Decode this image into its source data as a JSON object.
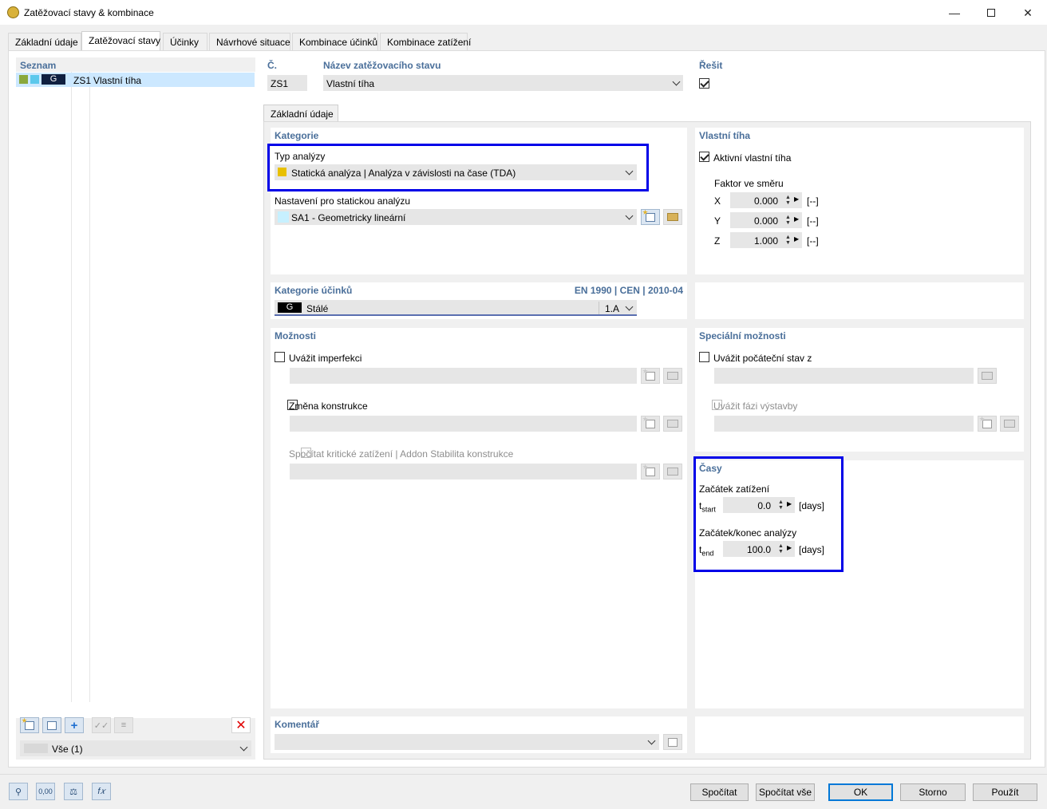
{
  "window": {
    "title": "Zatěžovací stavy & kombinace"
  },
  "tabs": [
    "Základní údaje",
    "Zatěžovací stavy",
    "Účinky",
    "Návrhové situace",
    "Kombinace účinků",
    "Kombinace zatížení"
  ],
  "list": {
    "header": "Seznam",
    "item": {
      "tag": "G",
      "id": "ZS1",
      "name": "Vlastní tíha",
      "colors": [
        "#8aa83c",
        "#5bc8ec"
      ]
    },
    "filter": "Vše (1)"
  },
  "number": {
    "label": "Č.",
    "value": "ZS1"
  },
  "name": {
    "label": "Název zatěžovacího stavu",
    "value": "Vlastní tíha"
  },
  "solve": {
    "label": "Řešit",
    "checked": true
  },
  "subtab": "Základní údaje",
  "category": {
    "header": "Kategorie",
    "analysis_type_label": "Typ analýzy",
    "analysis_type_value": "Statická analýza | Analýza v závislosti na čase (TDA)",
    "analysis_type_color": "#e8c000",
    "settings_label": "Nastavení pro statickou analýzu",
    "settings_value": "SA1 - Geometricky lineární",
    "settings_color": "#c7f0ff"
  },
  "self_weight": {
    "header": "Vlastní tíha",
    "active_label": "Aktivní vlastní tíha",
    "active_checked": true,
    "factor_label": "Faktor ve směru",
    "rows": [
      {
        "axis": "X",
        "value": "0.000",
        "unit": "[--]"
      },
      {
        "axis": "Y",
        "value": "0.000",
        "unit": "[--]"
      },
      {
        "axis": "Z",
        "value": "1.000",
        "unit": "[--]"
      }
    ]
  },
  "action_category": {
    "header": "Kategorie účinků",
    "standard": "EN 1990 | CEN | 2010-04",
    "tag": "G",
    "value": "Stálé",
    "code": "1.A"
  },
  "options": {
    "header": "Možnosti",
    "imperfection": "Uvážit imperfekci",
    "structure_change": "Změna konstrukce",
    "critical_load": "Spočítat kritické zatížení | Addon Stabilita konstrukce"
  },
  "special_options": {
    "header": "Speciální možnosti",
    "initial_state": "Uvážit počáteční stav z",
    "construction_stage": "Uvážit fázi výstavby"
  },
  "times": {
    "header": "Časy",
    "start_label": "Začátek zatížení",
    "start_sym": "t",
    "start_sub": "start",
    "start_value": "0.0",
    "start_unit": "[days]",
    "end_label": "Začátek/konec analýzy",
    "end_sym": "t",
    "end_sub": "end",
    "end_value": "100.0",
    "end_unit": "[days]"
  },
  "comment": {
    "header": "Komentář"
  },
  "buttons": {
    "calc": "Spočítat",
    "calc_all": "Spočítat vše",
    "ok": "OK",
    "cancel": "Storno",
    "apply": "Použít"
  },
  "bottom_icons": {
    "values_label": "0,00",
    "formula_label": "f𝑥"
  }
}
